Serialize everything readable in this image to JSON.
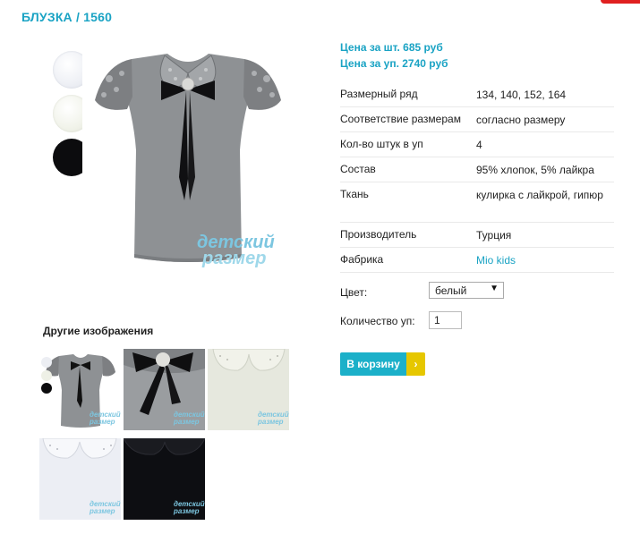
{
  "page": {
    "title": "БЛУЗКА / 1560"
  },
  "gallery": {
    "other_images_label": "Другие изображения",
    "logo_text": [
      "детский",
      "размер"
    ]
  },
  "prices": {
    "per_piece": "Цена за шт. 685 руб",
    "per_pack": "Цена за уп. 2740 руб"
  },
  "specs": [
    {
      "label": "Размерный ряд",
      "value": "134, 140, 152, 164"
    },
    {
      "label": "Соответствие размерам",
      "value": "согласно размеру"
    },
    {
      "label": "Кол-во штук в уп",
      "value": "4"
    },
    {
      "label": "Состав",
      "value": "95% хлопок, 5% лайкра"
    },
    {
      "label": "Ткань",
      "value": "кулирка с лайкрой, гипюр"
    },
    {
      "label": "Производитель",
      "value": "Турция"
    },
    {
      "label": "Фабрика",
      "value": "Mio kids"
    }
  ],
  "form": {
    "color_label": "Цвет:",
    "color_value": "белый",
    "qty_label": "Количество уп:",
    "qty_value": "1"
  },
  "cart_button": {
    "label": "В корзину",
    "chevron": "›"
  },
  "colors": {
    "accent": "#1aa3c4",
    "button": "#1cb0c9",
    "button_chevron": "#e6c700"
  }
}
